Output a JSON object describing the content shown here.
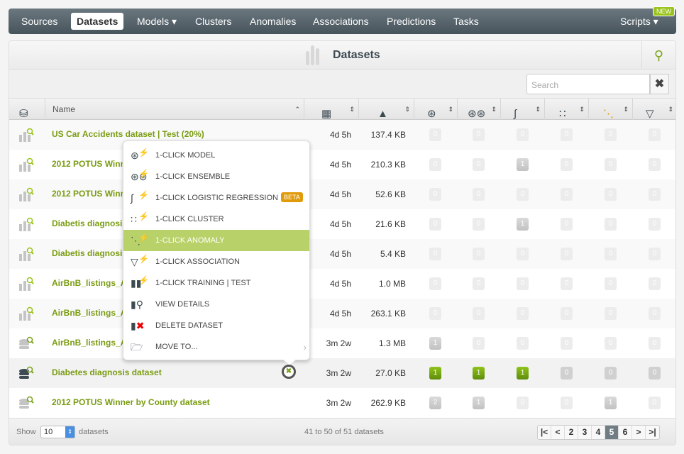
{
  "nav": {
    "items": [
      "Sources",
      "Datasets",
      "Models ▾",
      "Clusters",
      "Anomalies",
      "Associations",
      "Predictions",
      "Tasks"
    ],
    "scripts": "Scripts ▾",
    "new_badge": "NEW",
    "active": "Datasets"
  },
  "panel": {
    "title": "Datasets",
    "search_placeholder": "Search",
    "clear": "✖"
  },
  "columns": {
    "name": "Name"
  },
  "rows": [
    {
      "name": "US Car Accidents dataset | Test (20%)",
      "age": "4d 5h",
      "size": "137.4 KB",
      "counts": [
        0,
        0,
        0,
        0,
        0,
        0
      ],
      "type": "dataset"
    },
    {
      "name": "2012 POTUS Winn",
      "age": "4d 5h",
      "size": "210.3 KB",
      "counts": [
        0,
        0,
        1,
        0,
        0,
        0
      ],
      "type": "dataset"
    },
    {
      "name": "2012 POTUS Winn",
      "age": "4d 5h",
      "size": "52.6 KB",
      "counts": [
        0,
        0,
        0,
        0,
        0,
        0
      ],
      "type": "dataset"
    },
    {
      "name": "Diabetis diagnosis",
      "age": "4d 5h",
      "size": "21.6 KB",
      "counts": [
        0,
        0,
        1,
        0,
        0,
        0
      ],
      "type": "dataset"
    },
    {
      "name": "Diabetis diagnosis",
      "age": "4d 5h",
      "size": "5.4 KB",
      "counts": [
        0,
        0,
        0,
        0,
        0,
        0
      ],
      "type": "dataset"
    },
    {
      "name": "AirBnB_listings_A",
      "age": "4d 5h",
      "size": "1.0 MB",
      "counts": [
        0,
        0,
        0,
        0,
        0,
        0
      ],
      "type": "dataset"
    },
    {
      "name": "AirBnB_listings_A",
      "age": "4d 5h",
      "size": "263.1 KB",
      "counts": [
        0,
        0,
        0,
        0,
        0,
        0
      ],
      "type": "dataset"
    },
    {
      "name": "AirBnB_listings_A",
      "age": "3m 2w",
      "size": "1.3 MB",
      "counts": [
        1,
        0,
        0,
        0,
        0,
        0
      ],
      "type": "db"
    },
    {
      "name": "Diabetes diagnosis dataset",
      "age": "3m 2w",
      "size": "27.0 KB",
      "counts": [
        1,
        1,
        1,
        0,
        0,
        0
      ],
      "type": "db-dark",
      "highlight": true
    },
    {
      "name": "2012 POTUS Winner by County dataset",
      "age": "3m 2w",
      "size": "262.9 KB",
      "counts": [
        2,
        1,
        0,
        0,
        1,
        0
      ],
      "type": "db"
    }
  ],
  "menu": {
    "items": [
      {
        "label": "1-CLICK MODEL",
        "icon": "model-icon"
      },
      {
        "label": "1-CLICK ENSEMBLE",
        "icon": "ensemble-icon"
      },
      {
        "label": "1-CLICK LOGISTIC REGRESSION",
        "icon": "logistic-icon",
        "badge": "BETA"
      },
      {
        "label": "1-CLICK CLUSTER",
        "icon": "cluster-icon"
      },
      {
        "label": "1-CLICK ANOMALY",
        "icon": "anomaly-icon",
        "selected": true
      },
      {
        "label": "1-CLICK ASSOCIATION",
        "icon": "association-icon"
      },
      {
        "label": "1-CLICK TRAINING | TEST",
        "icon": "training-test-icon"
      },
      {
        "label": "VIEW DETAILS",
        "icon": "view-details-icon"
      },
      {
        "label": "DELETE DATASET",
        "icon": "delete-icon"
      },
      {
        "label": "MOVE TO...",
        "icon": "move-icon",
        "submenu": true
      }
    ]
  },
  "footer": {
    "show": "Show",
    "per_page": "10",
    "datasets": "datasets",
    "range": "41 to 50 of 51 datasets",
    "pages": [
      "2",
      "3",
      "4",
      "5",
      "6"
    ],
    "current_page": "5"
  },
  "colors": {
    "accent": "#7a9c12",
    "nav": "#4f5d65",
    "selected": "#b8d169",
    "beta": "#e09b0b"
  }
}
